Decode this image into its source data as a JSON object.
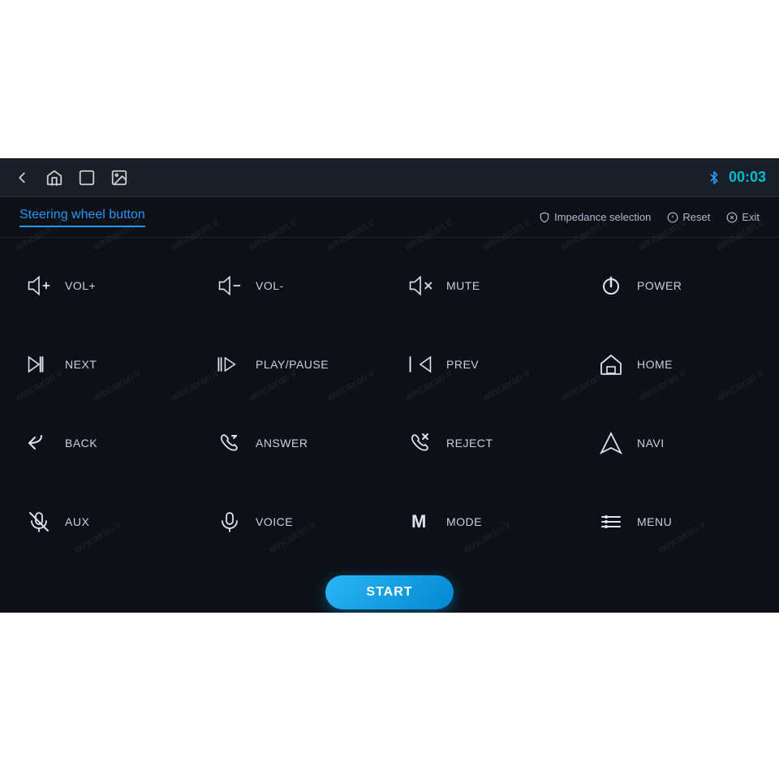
{
  "topWhiteHeight": 195,
  "bottomWhiteHeight": 205,
  "topBar": {
    "time": "00:03",
    "icons": [
      "back-arrow",
      "home",
      "window",
      "image"
    ]
  },
  "header": {
    "title": "Steering wheel button",
    "actions": [
      {
        "id": "impedance-selection",
        "label": "Impedance selection",
        "icon": "shield"
      },
      {
        "id": "reset",
        "label": "Reset",
        "icon": "reset-circle"
      },
      {
        "id": "exit",
        "label": "Exit",
        "icon": "exit-circle"
      }
    ]
  },
  "controls": [
    {
      "id": "vol-plus",
      "label": "VOL+",
      "icon": "vol-plus"
    },
    {
      "id": "vol-minus",
      "label": "VOL-",
      "icon": "vol-minus"
    },
    {
      "id": "mute",
      "label": "MUTE",
      "icon": "mute"
    },
    {
      "id": "power",
      "label": "POWER",
      "icon": "power"
    },
    {
      "id": "next",
      "label": "NEXT",
      "icon": "next"
    },
    {
      "id": "play-pause",
      "label": "PLAY/PAUSE",
      "icon": "play-pause"
    },
    {
      "id": "prev",
      "label": "PREV",
      "icon": "prev"
    },
    {
      "id": "home",
      "label": "HOME",
      "icon": "home"
    },
    {
      "id": "back",
      "label": "BACK",
      "icon": "back"
    },
    {
      "id": "answer",
      "label": "ANSWER",
      "icon": "answer"
    },
    {
      "id": "reject",
      "label": "REJECT",
      "icon": "reject"
    },
    {
      "id": "navi",
      "label": "NAVI",
      "icon": "navi"
    },
    {
      "id": "aux",
      "label": "AUX",
      "icon": "aux"
    },
    {
      "id": "voice",
      "label": "VOICE",
      "icon": "voice"
    },
    {
      "id": "mode",
      "label": "MODE",
      "icon": "mode"
    },
    {
      "id": "menu",
      "label": "MENU",
      "icon": "menu"
    }
  ],
  "startButton": {
    "label": "START"
  },
  "watermarkText": "wincairan.ir"
}
